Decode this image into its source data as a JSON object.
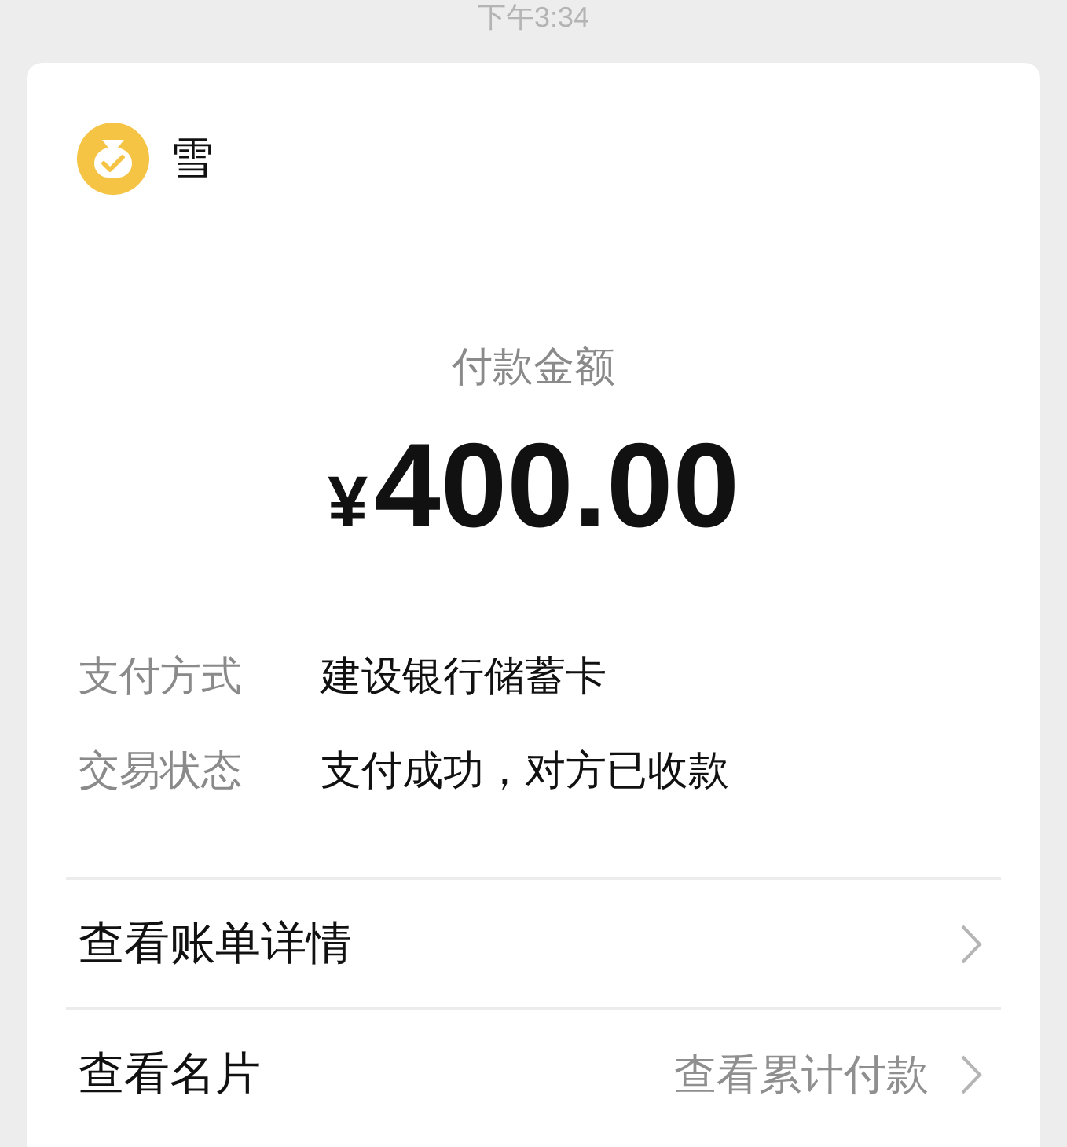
{
  "status_bar": {
    "time": "下午3:34"
  },
  "payee": {
    "name": "雪"
  },
  "amount": {
    "label": "付款金额",
    "currency": "¥",
    "value": "400.00"
  },
  "details": [
    {
      "label": "支付方式",
      "value": "建设银行储蓄卡"
    },
    {
      "label": "交易状态",
      "value": "支付成功，对方已收款"
    }
  ],
  "links": [
    {
      "label": "查看账单详情"
    },
    {
      "label": "查看名片",
      "hint": "查看累计付款"
    }
  ]
}
